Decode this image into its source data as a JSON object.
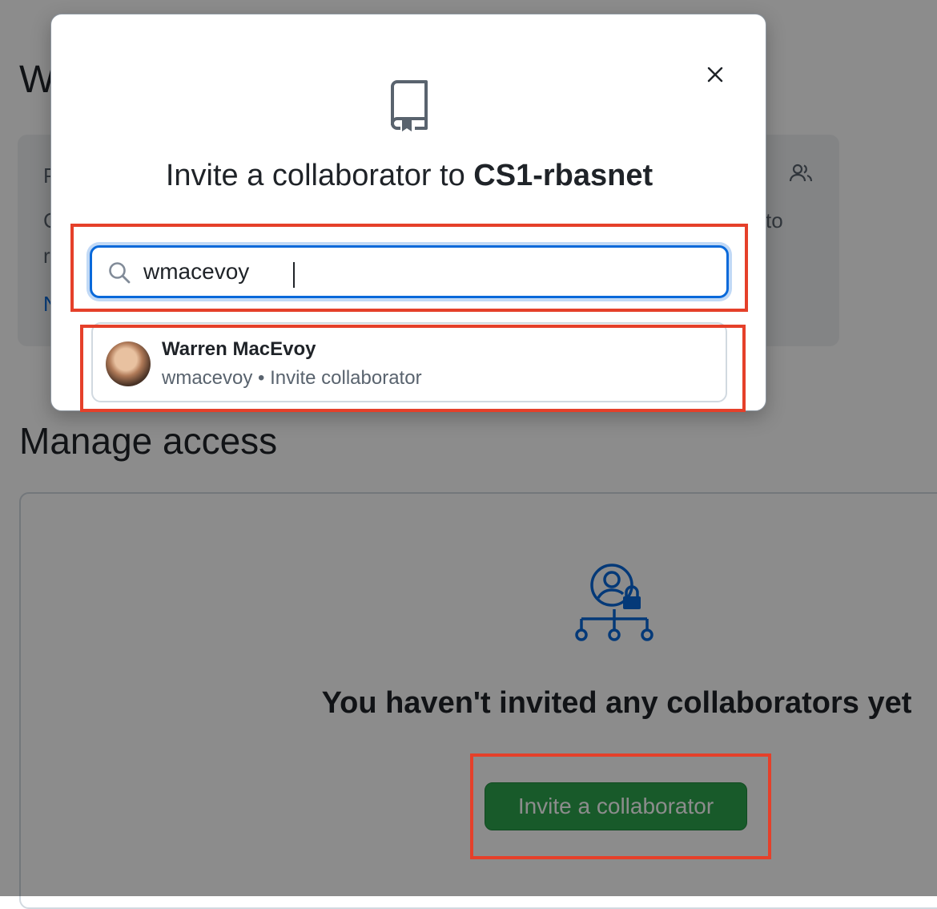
{
  "background": {
    "heading_fragment": "W",
    "card": {
      "fragments": [
        "P",
        "C",
        "r",
        "N",
        "to"
      ]
    },
    "manage_access_title": "Manage access",
    "empty_state": {
      "title": "You haven't invited any collaborators yet",
      "invite_button_label": "Invite a collaborator"
    }
  },
  "dialog": {
    "title_prefix": "Invite a collaborator to ",
    "repo_name": "CS1-rbasnet",
    "search": {
      "value": "wmacevoy",
      "placeholder": ""
    },
    "results": [
      {
        "name": "Warren MacEvoy",
        "username": "wmacevoy",
        "separator": "•",
        "action": "Invite collaborator"
      }
    ]
  },
  "colors": {
    "accent_blue": "#0969da",
    "primary_green": "#2da44e",
    "highlight_red": "#e5402a"
  }
}
